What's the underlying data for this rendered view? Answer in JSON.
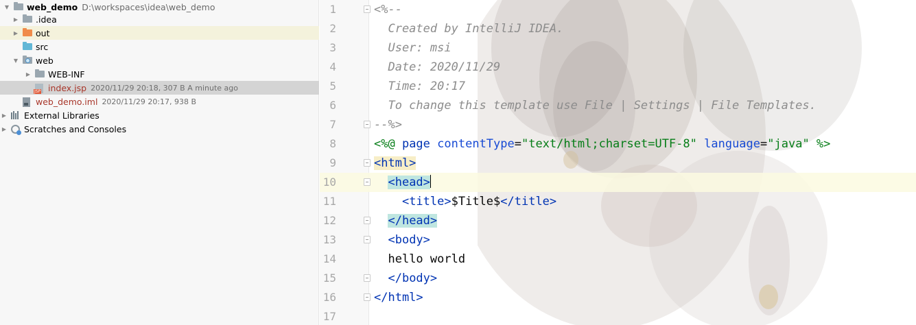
{
  "project_tree": {
    "root": {
      "name": "web_demo",
      "path": "D:\\workspaces\\idea\\web_demo"
    },
    "items": [
      {
        "label": ".idea"
      },
      {
        "label": "out"
      },
      {
        "label": "src"
      },
      {
        "label": "web"
      },
      {
        "label": "WEB-INF"
      },
      {
        "label": "index.jsp",
        "meta": "2020/11/29 20:18, 307 B  A minute ago"
      },
      {
        "label": "web_demo.iml",
        "meta": "2020/11/29 20:17, 938 B"
      },
      {
        "label": "External Libraries"
      },
      {
        "label": "Scratches and Consoles"
      }
    ]
  },
  "editor": {
    "lines": [
      {
        "n": "1",
        "text": "<%--"
      },
      {
        "n": "2",
        "text": "  Created by IntelliJ IDEA."
      },
      {
        "n": "3",
        "text": "  User: msi"
      },
      {
        "n": "4",
        "text": "  Date: 2020/11/29"
      },
      {
        "n": "5",
        "text": "  Time: 20:17"
      },
      {
        "n": "6",
        "text": "  To change this template use File | Settings | File Templates."
      },
      {
        "n": "7",
        "text": "--%>"
      },
      {
        "n": "8",
        "parts": [
          "<%@ ",
          "page",
          " ",
          "contentType",
          "=",
          "\"text/html;charset=UTF-8\"",
          " ",
          "language",
          "=",
          "\"java\"",
          " %>"
        ]
      },
      {
        "n": "9",
        "text": "<html>"
      },
      {
        "n": "10",
        "text": "<head>"
      },
      {
        "n": "11",
        "parts": [
          "<title>",
          "$Title$",
          "</title>"
        ]
      },
      {
        "n": "12",
        "text": "</head>"
      },
      {
        "n": "13",
        "text": "<body>"
      },
      {
        "n": "14",
        "text": "hello world"
      },
      {
        "n": "15",
        "text": "</body>"
      },
      {
        "n": "16",
        "text": "</html>"
      },
      {
        "n": "17",
        "text": ""
      }
    ]
  },
  "colors": {
    "comment": "#8c8c8c",
    "keyword": "#0033b3",
    "string": "#067d17",
    "selected_row": "#d4d4d4",
    "hover_row": "#f4f2dc",
    "caret_line": "#fcfae0"
  }
}
